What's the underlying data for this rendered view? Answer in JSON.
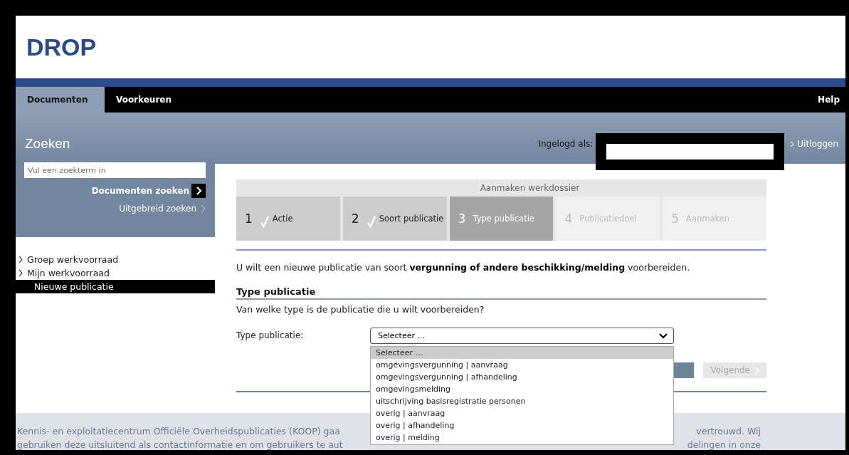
{
  "logo": "DROP",
  "nav": {
    "tabs": [
      {
        "label": "Documenten",
        "selected": true
      },
      {
        "label": "Voorkeuren",
        "selected": false
      }
    ],
    "help": "Help"
  },
  "header": {
    "title": "Zoeken",
    "logged_in_label": "Ingelogd als:",
    "logout": "Uitloggen"
  },
  "search": {
    "placeholder": "Vul een zoekterm in",
    "search_button": "Documenten zoeken",
    "advanced": "Uitgebreid zoeken"
  },
  "sidebar": {
    "items": [
      {
        "label": "Groep werkvoorraad",
        "selected": false
      },
      {
        "label": "Mijn werkvoorraad",
        "selected": false
      },
      {
        "label": "Nieuwe publicatie",
        "selected": true
      }
    ]
  },
  "wizard": {
    "title": "Aanmaken werkdossier",
    "steps": [
      {
        "number": "1",
        "label": "Actie",
        "completed": true,
        "selected": false
      },
      {
        "number": "2",
        "label": "Soort publicatie",
        "completed": true,
        "selected": false
      },
      {
        "number": "3",
        "label": "Type publicatie",
        "completed": false,
        "selected": true
      },
      {
        "number": "4",
        "label": "Publicatiedoel",
        "completed": false,
        "selected": false
      },
      {
        "number": "5",
        "label": "Aanmaken",
        "completed": false,
        "selected": false
      }
    ]
  },
  "intro": "U wilt een nieuwe publicatie van soort **vergunning of andere beschikking/melding** voorbereiden.",
  "section": {
    "title": "Type publicatie",
    "question": "Van welke type is de publicatie die u wilt voorbereiden?"
  },
  "field": {
    "label": "Type publicatie:",
    "value": "Selecteer ...",
    "expanded": true,
    "options": [
      {
        "label": "Selecteer ...",
        "selected": true
      },
      {
        "label": "omgevingsvergunning | aanvraag",
        "selected": false
      },
      {
        "label": "omgevingsvergunning | afhandeling",
        "selected": false
      },
      {
        "label": "omgevingsmelding",
        "selected": false
      },
      {
        "label": "uitschrijving basisregistratie personen",
        "selected": false
      },
      {
        "label": "overig | aanvraag",
        "selected": false
      },
      {
        "label": "overig | afhandeling",
        "selected": false
      },
      {
        "label": "overig | melding",
        "selected": false
      }
    ]
  },
  "buttons": {
    "next": {
      "label": "Volgende",
      "disabled": true
    }
  },
  "footer": {
    "lines": [
      {
        "left": "Kennis- en exploitatiecentrum Officiële Overheidspublicaties (KOOP) gaa",
        "right": "vertrouwd. Wij"
      },
      {
        "left": "gebruiken deze uitsluitend als contactinformatie en om gebruikers te aut",
        "right": "delingen in onze"
      }
    ]
  }
}
